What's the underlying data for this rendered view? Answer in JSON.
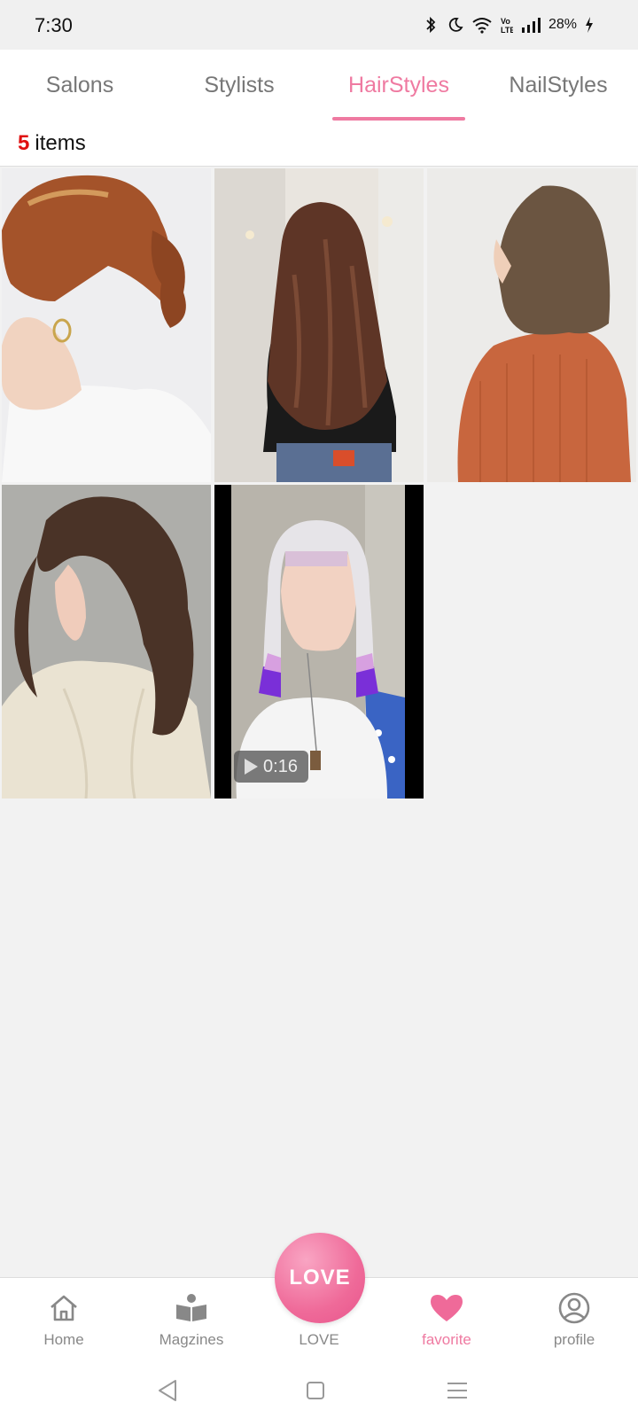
{
  "status_bar": {
    "time": "7:30",
    "battery": "28%"
  },
  "tabs": [
    {
      "label": "Salons",
      "active": false
    },
    {
      "label": "Stylists",
      "active": false
    },
    {
      "label": "HairStyles",
      "active": true
    },
    {
      "label": "NailStyles",
      "active": false
    }
  ],
  "items_header": {
    "count": "5",
    "label": "items"
  },
  "grid": {
    "tiles": [
      {
        "icon": "hairstyle-photo",
        "type": "image"
      },
      {
        "icon": "hairstyle-photo",
        "type": "image"
      },
      {
        "icon": "hairstyle-photo",
        "type": "image"
      },
      {
        "icon": "hairstyle-photo",
        "type": "image"
      },
      {
        "icon": "hairstyle-video",
        "type": "video",
        "duration": "0:16"
      }
    ]
  },
  "bottom_nav": {
    "items": [
      {
        "label": "Home",
        "icon": "home-icon",
        "active": false
      },
      {
        "label": "Magzines",
        "icon": "book-icon",
        "active": false
      },
      {
        "label": "LOVE",
        "icon": "love-icon",
        "active": false
      },
      {
        "label": "favorite",
        "icon": "heart-icon",
        "active": true
      },
      {
        "label": "profile",
        "icon": "profile-icon",
        "active": false
      }
    ],
    "fab_label": "LOVE"
  },
  "colors": {
    "accent": "#ef7aa1",
    "count": "#e01010"
  }
}
